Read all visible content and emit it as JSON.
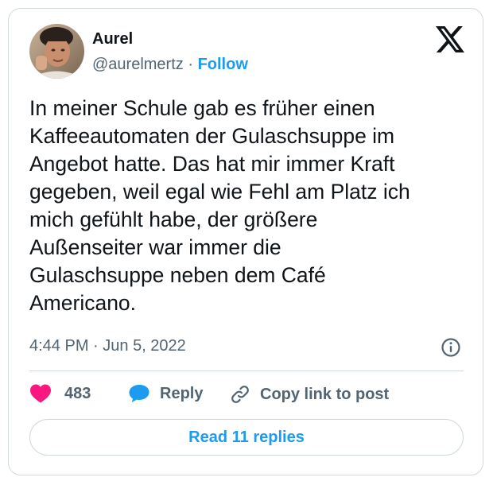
{
  "author": {
    "name": "Aurel",
    "handle": "@aurelmertz",
    "separator": " · ",
    "follow_label": "Follow",
    "avatar": "profile-photo"
  },
  "platform_icon": "x-logo-icon",
  "tweet": {
    "text": "In meiner Schule gab es früher einen\nKaffeeautomaten der Gulaschsuppe im\nAngebot hatte. Das hat mir immer Kraft\ngegeben, weil egal wie Fehl am Platz ich\nmich gefühlt habe, der größere\nAußenseiter war immer die\nGulaschsuppe neben dem Café\nAmericano.",
    "time": "4:44 PM",
    "dot": " · ",
    "date": "Jun 5, 2022"
  },
  "actions": {
    "likes": "483",
    "reply_label": "Reply",
    "copy_label": "Copy link to post"
  },
  "read_replies_label": "Read 11 replies",
  "colors": {
    "accent": "#1d9bf0",
    "like": "#f91880",
    "text": "#0f1419",
    "secondary": "#536471",
    "border": "#cfd9de"
  }
}
